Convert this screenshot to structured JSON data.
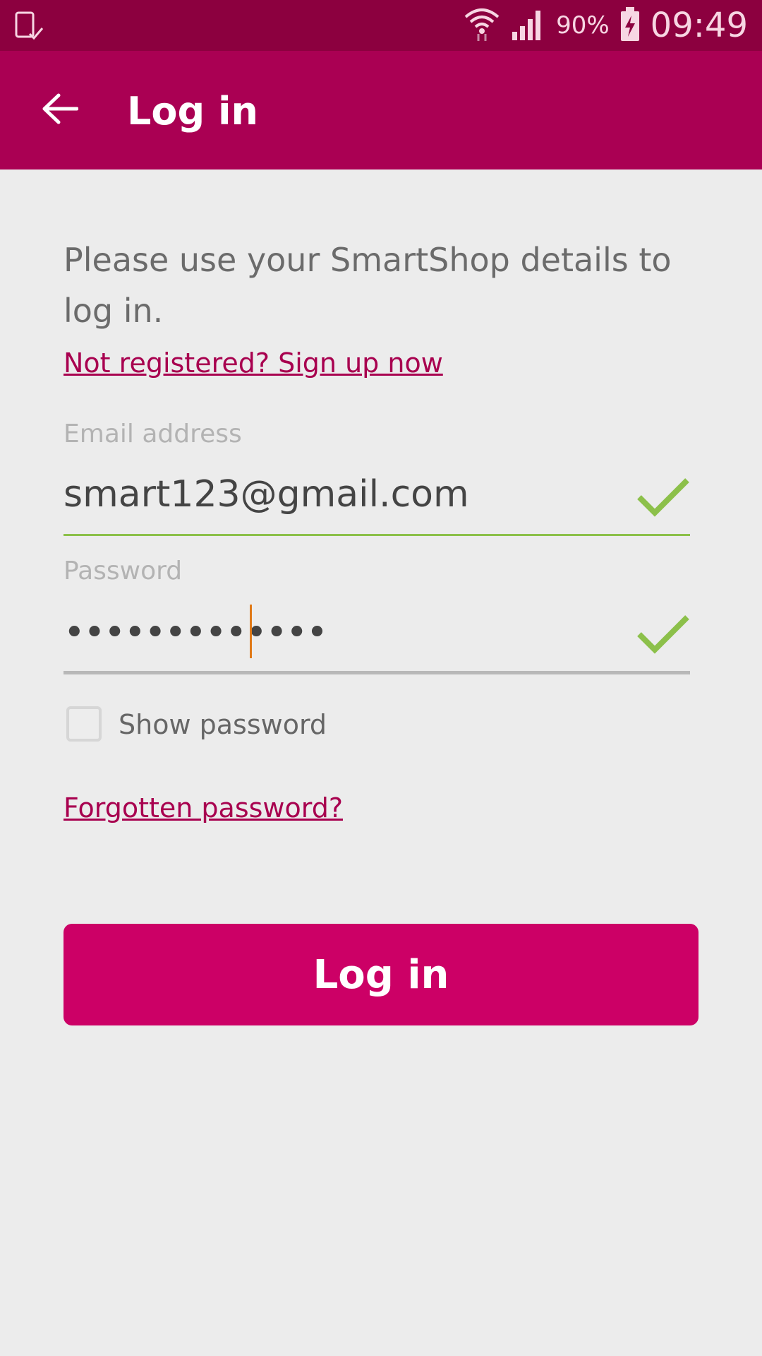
{
  "status_bar": {
    "battery_percent": "90%",
    "time": "09:49",
    "icons": [
      "notification-device-icon",
      "wifi-icon",
      "signal-icon",
      "battery-charging-icon"
    ]
  },
  "app_bar": {
    "title": "Log in",
    "back_icon": "arrow-left-icon",
    "background": "#aa0053"
  },
  "form": {
    "intro_text": "Please use your SmartShop details to log in.",
    "signup_link": "Not registered? Sign up now",
    "email": {
      "label": "Email address",
      "value": "smart123@gmail.com",
      "valid_icon": "check-icon"
    },
    "password": {
      "label": "Password",
      "value": "•••••••••••••",
      "valid_icon": "check-icon"
    },
    "show_password": {
      "label": "Show password",
      "checked": false
    },
    "forgot_link": "Forgotten password?",
    "submit_label": "Log in"
  },
  "colors": {
    "status_bar": "#8c003f",
    "accent": "#aa0053",
    "button": "#cc0066",
    "valid": "#8cc04a",
    "caret": "#e07a18"
  }
}
